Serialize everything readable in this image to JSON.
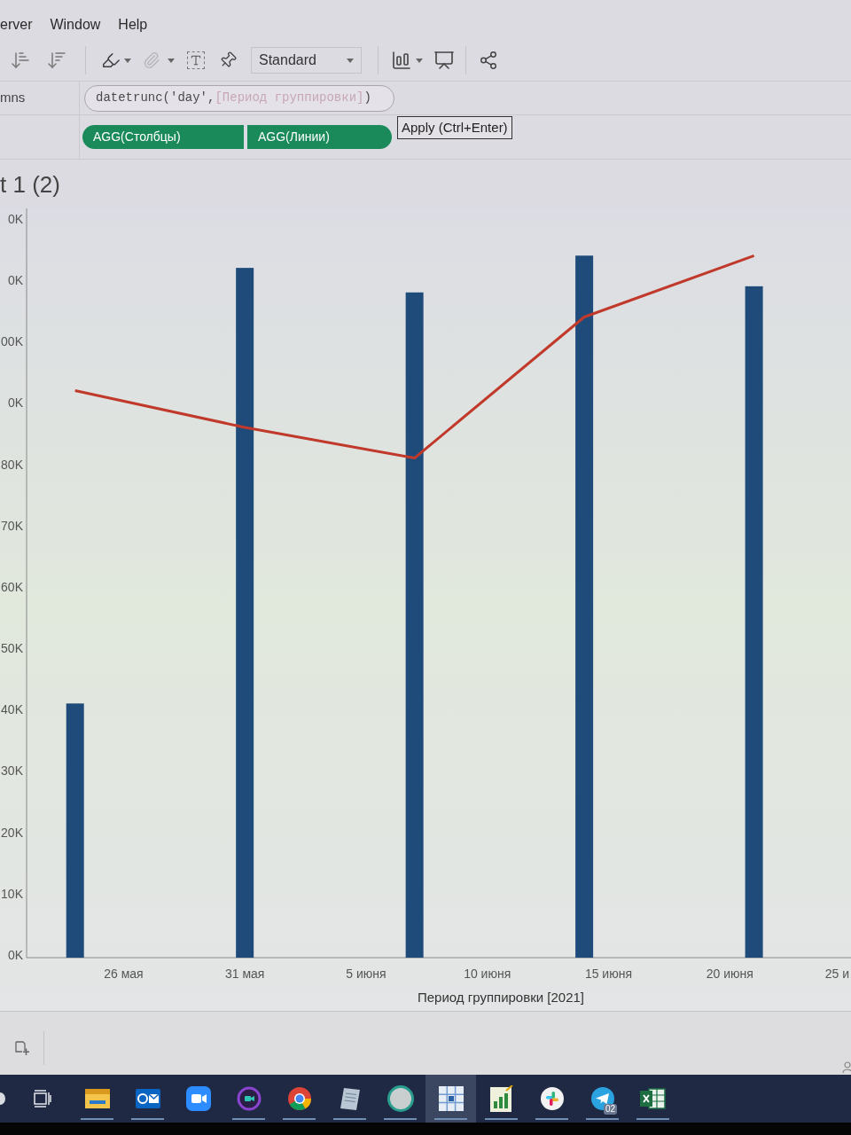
{
  "menu": [
    {
      "label": "erver"
    },
    {
      "label": "Window"
    },
    {
      "label": "Help"
    }
  ],
  "toolbar": {
    "tools": [
      {
        "disabled": false
      },
      {
        "disabled": true
      }
    ],
    "dropdown": {
      "value": "Standard"
    }
  },
  "shelves": [
    {
      "label": "mns",
      "pills": [
        {
          "text": "datetrunc('day',[Период группировки])",
          "kind": "editing"
        }
      ]
    },
    {
      "pills": [
        {
          "text": "AGG(Столбцы)",
          "kind": "measure"
        },
        {
          "text": "AGG(Линии)",
          "kind": "measure"
        }
      ]
    }
  ],
  "tooltip": {
    "text": "Apply (Ctrl+Enter)"
  },
  "sheet_title": "t 1 (2)",
  "y_axis_cut_labels": [
    "0K",
    "0K",
    "00K",
    "0K"
  ],
  "chart_data": {
    "type": "bar",
    "xlabel": "Период группировки [2021]",
    "x": [
      "2021-05-24",
      "2021-05-31",
      "2021-06-07",
      "2021-06-14",
      "2021-06-21"
    ],
    "series": [
      {
        "type": "bar",
        "color": "#1f4b7a",
        "values": [
          41000,
          112000,
          108000,
          114000,
          109000
        ]
      },
      {
        "type": "line",
        "color": "#c0392b",
        "values": [
          92000,
          86000,
          81000,
          104000,
          114000
        ]
      }
    ],
    "xlim": [
      "2021-05-22",
      "2021-06-25"
    ],
    "ylim": [
      0,
      121700
    ],
    "xticks": [
      {
        "value": "2021-05-26",
        "label": "26 мая"
      },
      {
        "value": "2021-05-31",
        "label": "31 мая"
      },
      {
        "value": "2021-06-05",
        "label": "5 июня"
      },
      {
        "value": "2021-06-10",
        "label": "10 июня"
      },
      {
        "value": "2021-06-15",
        "label": "15 июня"
      },
      {
        "value": "2021-06-20",
        "label": "20 июня"
      },
      {
        "value": "2021-06-25",
        "label": "25 и"
      }
    ],
    "yticks": [
      {
        "value": 0,
        "label": "0K"
      },
      {
        "value": 10000,
        "label": "10K"
      },
      {
        "value": 20000,
        "label": "20K"
      },
      {
        "value": 30000,
        "label": "30K"
      },
      {
        "value": 40000,
        "label": "40K"
      },
      {
        "value": 50000,
        "label": "50K"
      },
      {
        "value": 60000,
        "label": "60K"
      },
      {
        "value": 70000,
        "label": "70K"
      },
      {
        "value": 80000,
        "label": "80K"
      }
    ]
  },
  "taskbar": {
    "apps": [
      {
        "running": true,
        "selected": false
      },
      {
        "running": true,
        "selected": false
      },
      {
        "running": false,
        "selected": false
      },
      {
        "running": true,
        "selected": false
      },
      {
        "running": true,
        "selected": false
      },
      {
        "running": true,
        "selected": false
      },
      {
        "running": true,
        "selected": false
      },
      {
        "running": true,
        "selected": true
      },
      {
        "running": true,
        "selected": false
      },
      {
        "running": true,
        "selected": false
      },
      {
        "running": true,
        "selected": false,
        "badge": "02"
      },
      {
        "running": true,
        "selected": false
      }
    ]
  }
}
